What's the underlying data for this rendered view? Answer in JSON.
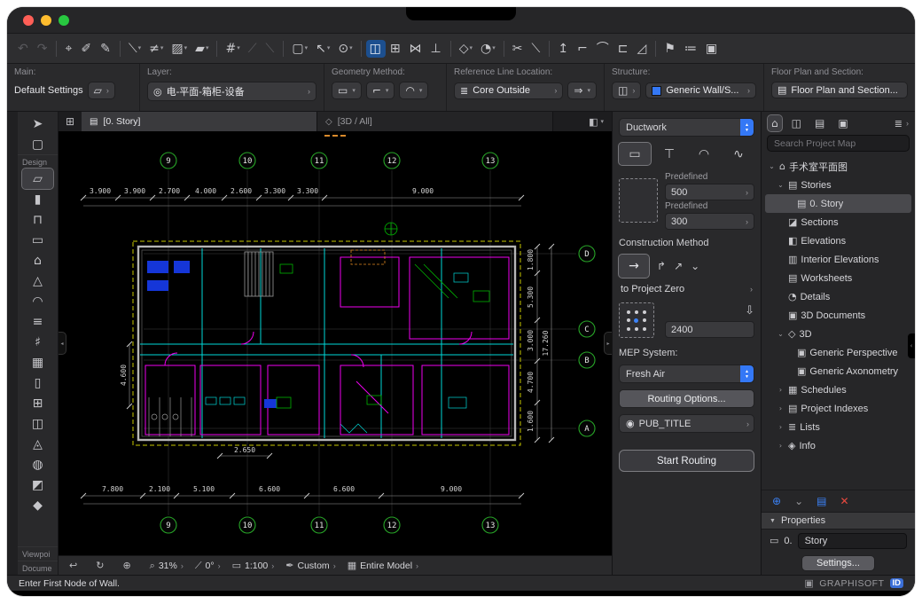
{
  "toolbar": {
    "icons": [
      {
        "name": "undo-icon",
        "glyph": "↶",
        "caret": "",
        "cls": "disabled",
        "inter": "true"
      },
      {
        "name": "redo-icon",
        "glyph": "↷",
        "caret": "",
        "cls": "disabled",
        "inter": "true"
      },
      {
        "name": "separator",
        "glyph": "",
        "caret": "",
        "cls": "sep",
        "inter": "false"
      },
      {
        "name": "find-select-icon",
        "glyph": "⌖",
        "caret": "",
        "cls": "",
        "inter": "true"
      },
      {
        "name": "pickup-parameters-icon",
        "glyph": "✐",
        "caret": "",
        "cls": "",
        "inter": "true"
      },
      {
        "name": "inject-parameters-icon",
        "glyph": "✎",
        "caret": "",
        "cls": "",
        "inter": "true"
      },
      {
        "name": "separator",
        "glyph": "",
        "caret": "",
        "cls": "sep",
        "inter": "false"
      },
      {
        "name": "line-style-icon",
        "glyph": "⟍",
        "caret": "▾",
        "cls": "",
        "inter": "true"
      },
      {
        "name": "dimension-style-icon",
        "glyph": "≠",
        "caret": "▾",
        "cls": "",
        "inter": "true"
      },
      {
        "name": "fill-style-icon",
        "glyph": "▨",
        "caret": "▾",
        "cls": "",
        "inter": "true"
      },
      {
        "name": "pen-set-icon",
        "glyph": "▰",
        "caret": "▾",
        "cls": "",
        "inter": "true"
      },
      {
        "name": "separator",
        "glyph": "",
        "caret": "",
        "cls": "sep",
        "inter": "false"
      },
      {
        "name": "grid-snap-icon",
        "glyph": "#",
        "caret": "▾",
        "cls": "",
        "inter": "true"
      },
      {
        "name": "guide-lines-icon",
        "glyph": "⟋",
        "caret": "",
        "cls": "disabled",
        "inter": "true"
      },
      {
        "name": "snap-guides-icon",
        "glyph": "⟍",
        "caret": "",
        "cls": "disabled",
        "inter": "true"
      },
      {
        "name": "separator",
        "glyph": "",
        "caret": "",
        "cls": "sep",
        "inter": "false"
      },
      {
        "name": "marquee-options-icon",
        "glyph": "▢",
        "caret": "▾",
        "cls": "",
        "inter": "true"
      },
      {
        "name": "cursor-snap-icon",
        "glyph": "↖",
        "caret": "▾",
        "cls": "",
        "inter": "true"
      },
      {
        "name": "suspend-groups-icon",
        "glyph": "⊙",
        "caret": "▾",
        "cls": "",
        "inter": "true"
      },
      {
        "name": "separator",
        "glyph": "",
        "caret": "",
        "cls": "sep",
        "inter": "false"
      },
      {
        "name": "magic-routing-icon",
        "glyph": "◫",
        "caret": "",
        "cls": "selected",
        "inter": "true"
      },
      {
        "name": "gravity-icon",
        "glyph": "⊞",
        "caret": "",
        "cls": "",
        "inter": "true"
      },
      {
        "name": "intersect-icon",
        "glyph": "⋈",
        "caret": "",
        "cls": "",
        "inter": "true"
      },
      {
        "name": "trim-icon",
        "glyph": "⊥",
        "caret": "",
        "cls": "",
        "inter": "true"
      },
      {
        "name": "separator",
        "glyph": "",
        "caret": "",
        "cls": "sep",
        "inter": "false"
      },
      {
        "name": "shape-options-icon",
        "glyph": "◇",
        "caret": "▾",
        "cls": "",
        "inter": "true"
      },
      {
        "name": "rotate-options-icon",
        "glyph": "◔",
        "caret": "▾",
        "cls": "",
        "inter": "true"
      },
      {
        "name": "separator",
        "glyph": "",
        "caret": "",
        "cls": "sep",
        "inter": "false"
      },
      {
        "name": "cut-icon",
        "glyph": "✂",
        "caret": "",
        "cls": "",
        "inter": "true"
      },
      {
        "name": "split-icon",
        "glyph": "⟍",
        "caret": "",
        "cls": "",
        "inter": "true"
      },
      {
        "name": "separator",
        "glyph": "",
        "caret": "",
        "cls": "sep",
        "inter": "false"
      },
      {
        "name": "elevate-icon",
        "glyph": "↥",
        "caret": "",
        "cls": "",
        "inter": "true"
      },
      {
        "name": "corner-icon",
        "glyph": "⌐",
        "caret": "",
        "cls": "",
        "inter": "true"
      },
      {
        "name": "fillet-icon",
        "glyph": "⌒",
        "caret": "",
        "cls": "",
        "inter": "true"
      },
      {
        "name": "stretch-icon",
        "glyph": "⊏",
        "caret": "",
        "cls": "",
        "inter": "true"
      },
      {
        "name": "resize-icon",
        "glyph": "◿",
        "caret": "",
        "cls": "",
        "inter": "true"
      },
      {
        "name": "separator",
        "glyph": "",
        "caret": "",
        "cls": "sep",
        "inter": "false"
      },
      {
        "name": "flag-icon",
        "glyph": "⚑",
        "caret": "",
        "cls": "",
        "inter": "true"
      },
      {
        "name": "markup-list-icon",
        "glyph": "≔",
        "caret": "",
        "cls": "",
        "inter": "true"
      },
      {
        "name": "layout-icon",
        "glyph": "▣",
        "caret": "",
        "cls": "",
        "inter": "true"
      }
    ]
  },
  "infobox": {
    "main_label": "Main:",
    "default_settings": "Default Settings",
    "layer_label": "Layer:",
    "layer_value": "电-平面-箱柜-设备",
    "geometry_label": "Geometry Method:",
    "refline_label": "Reference Line Location:",
    "refline_value": "Core Outside",
    "structure_label": "Structure:",
    "structure_value": "Generic Wall/S...",
    "floorplan_label": "Floor Plan and Section:",
    "floorplan_value": "Floor Plan and Section..."
  },
  "tabs": {
    "items": [
      {
        "name": "tab-story",
        "glyph": "▤",
        "label": "[0. Story]",
        "cls": "active",
        "inter": "true"
      },
      {
        "name": "tab-3d-all",
        "glyph": "◇",
        "label": "[3D / All]",
        "cls": "",
        "inter": "true"
      }
    ],
    "right_glyph": "◧",
    "right_caret": "▾"
  },
  "toolbox": {
    "items": [
      {
        "name": "arrow-tool",
        "glyph": "➤",
        "label": "",
        "cls": "tool",
        "inter": "true"
      },
      {
        "name": "marquee-tool",
        "glyph": "▢",
        "label": "",
        "cls": "tool",
        "inter": "true"
      },
      {
        "name": "section-design-label",
        "glyph": "",
        "label": "Design",
        "cls": "label",
        "inter": "false"
      },
      {
        "name": "wall-tool",
        "glyph": "▱",
        "label": "",
        "cls": "tool selected",
        "inter": "true"
      },
      {
        "name": "column-tool",
        "glyph": "▮",
        "label": "",
        "cls": "tool",
        "inter": "true"
      },
      {
        "name": "beam-tool",
        "glyph": "⊓",
        "label": "",
        "cls": "tool",
        "inter": "true"
      },
      {
        "name": "slab-tool",
        "glyph": "▭",
        "label": "",
        "cls": "tool",
        "inter": "true"
      },
      {
        "name": "roof-tool",
        "glyph": "⌂",
        "label": "",
        "cls": "tool",
        "inter": "true"
      },
      {
        "name": "mesh-tool",
        "glyph": "△",
        "label": "",
        "cls": "tool",
        "inter": "true"
      },
      {
        "name": "shell-tool",
        "glyph": "◠",
        "label": "",
        "cls": "tool",
        "inter": "true"
      },
      {
        "name": "stair-tool",
        "glyph": "≡",
        "label": "",
        "cls": "tool",
        "inter": "true"
      },
      {
        "name": "railing-tool",
        "glyph": "♯",
        "label": "",
        "cls": "tool",
        "inter": "true"
      },
      {
        "name": "curtain-wall-tool",
        "glyph": "▦",
        "label": "",
        "cls": "tool",
        "inter": "true"
      },
      {
        "name": "door-tool",
        "glyph": "▯",
        "label": "",
        "cls": "tool",
        "inter": "true"
      },
      {
        "name": "window-tool",
        "glyph": "⊞",
        "label": "",
        "cls": "tool",
        "inter": "true"
      },
      {
        "name": "skylight-tool",
        "glyph": "◫",
        "label": "",
        "cls": "tool",
        "inter": "true"
      },
      {
        "name": "object-tool",
        "glyph": "◬",
        "label": "",
        "cls": "tool",
        "inter": "true"
      },
      {
        "name": "lamp-tool",
        "glyph": "◍",
        "label": "",
        "cls": "tool",
        "inter": "true"
      },
      {
        "name": "zone-tool",
        "glyph": "◩",
        "label": "",
        "cls": "tool",
        "inter": "true"
      },
      {
        "name": "morph-tool",
        "glyph": "◆",
        "label": "",
        "cls": "tool",
        "inter": "true"
      },
      {
        "name": "section-viewpoint-label",
        "glyph": "",
        "label": "Viewpoi",
        "cls": "label push",
        "inter": "false"
      },
      {
        "name": "section-document-label",
        "glyph": "",
        "label": "Docume",
        "cls": "label",
        "inter": "false"
      }
    ]
  },
  "settings": {
    "element_type": "Ductwork",
    "geometry_icons": [
      {
        "name": "duct-straight-icon",
        "glyph": "▭",
        "cls": "selected",
        "inter": "true"
      },
      {
        "name": "duct-branch-icon",
        "glyph": "⊤",
        "cls": "",
        "inter": "true"
      },
      {
        "name": "duct-elbow-icon",
        "glyph": "◠",
        "cls": "",
        "inter": "true"
      },
      {
        "name": "duct-flexible-icon",
        "glyph": "∿",
        "cls": "",
        "inter": "true"
      }
    ],
    "predefined_label_1": "Predefined",
    "size_1": "500",
    "predefined_label_2": "Predefined",
    "size_2": "300",
    "construction_method_label": "Construction Method",
    "reference_label": "to Project Zero",
    "elevation_value": "2400",
    "mep_label": "MEP System:",
    "mep_value": "Fresh Air",
    "routing_options_label": "Routing Options...",
    "pub_title": "PUB_TITLE",
    "start_routing_label": "Start Routing"
  },
  "navigator": {
    "header_icons": [
      {
        "name": "project-map-icon",
        "glyph": "⌂",
        "cls": "selected",
        "inter": "true"
      },
      {
        "name": "view-map-icon",
        "glyph": "◫",
        "cls": "",
        "inter": "true"
      },
      {
        "name": "layout-book-icon",
        "glyph": "▤",
        "cls": "",
        "inter": "true"
      },
      {
        "name": "publisher-sets-icon",
        "glyph": "▣",
        "cls": "",
        "inter": "true"
      }
    ],
    "menu_icon": "≣",
    "menu_chev": "›",
    "search_placeholder": "Search Project Map",
    "tree": [
      {
        "name": "tree-project-root",
        "chev": "⌄",
        "glyph": "⌂",
        "label": "手术室平面图",
        "cls": "ind0",
        "inter": "true"
      },
      {
        "name": "tree-stories",
        "chev": "⌄",
        "glyph": "▤",
        "label": "Stories",
        "cls": "ind1",
        "inter": "true"
      },
      {
        "name": "tree-story-0",
        "chev": "",
        "glyph": "▤",
        "label": "0. Story",
        "cls": "ind2 selected",
        "inter": "true"
      },
      {
        "name": "tree-sections",
        "chev": "",
        "glyph": "◪",
        "label": "Sections",
        "cls": "ind1",
        "inter": "true"
      },
      {
        "name": "tree-elevations",
        "chev": "",
        "glyph": "◧",
        "label": "Elevations",
        "cls": "ind1",
        "inter": "true"
      },
      {
        "name": "tree-interior-elevations",
        "chev": "",
        "glyph": "▥",
        "label": "Interior Elevations",
        "cls": "ind1",
        "inter": "true"
      },
      {
        "name": "tree-worksheets",
        "chev": "",
        "glyph": "▤",
        "label": "Worksheets",
        "cls": "ind1",
        "inter": "true"
      },
      {
        "name": "tree-details",
        "chev": "",
        "glyph": "◔",
        "label": "Details",
        "cls": "ind1",
        "inter": "true"
      },
      {
        "name": "tree-3d-documents",
        "chev": "",
        "glyph": "▣",
        "label": "3D Documents",
        "cls": "ind1",
        "inter": "true"
      },
      {
        "name": "tree-3d",
        "chev": "⌄",
        "glyph": "◇",
        "label": "3D",
        "cls": "ind1",
        "inter": "true"
      },
      {
        "name": "tree-generic-perspective",
        "chev": "",
        "glyph": "▣",
        "label": "Generic Perspective",
        "cls": "ind2",
        "inter": "true"
      },
      {
        "name": "tree-generic-axonometry",
        "chev": "",
        "glyph": "▣",
        "label": "Generic Axonometry",
        "cls": "ind2",
        "inter": "true"
      },
      {
        "name": "tree-schedules",
        "chev": "›",
        "glyph": "▦",
        "label": "Schedules",
        "cls": "ind1",
        "inter": "true"
      },
      {
        "name": "tree-project-indexes",
        "chev": "›",
        "glyph": "▤",
        "label": "Project Indexes",
        "cls": "ind1",
        "inter": "true"
      },
      {
        "name": "tree-lists",
        "chev": "›",
        "glyph": "≣",
        "label": "Lists",
        "cls": "ind1",
        "inter": "true"
      },
      {
        "name": "tree-info",
        "chev": "›",
        "glyph": "◈",
        "label": "Info",
        "cls": "ind1",
        "inter": "true"
      }
    ],
    "util_icons": [
      {
        "name": "add-viewpoint-icon",
        "glyph": "⊕",
        "cls": "blue",
        "inter": "true"
      },
      {
        "name": "collapse-all-icon",
        "glyph": "⌄",
        "cls": "",
        "inter": "true"
      },
      {
        "name": "clone-folder-icon",
        "glyph": "▤",
        "cls": "blue",
        "inter": "true"
      },
      {
        "name": "delete-item-icon",
        "glyph": "✕",
        "cls": "red",
        "inter": "true"
      }
    ],
    "properties_label": "Properties",
    "prop_story_prefix": "0.",
    "prop_story_value": "Story",
    "settings_button": "Settings..."
  },
  "bottombar": {
    "items": [
      {
        "name": "previous-view-icon",
        "icon": "↩",
        "text": "",
        "caret": "",
        "inter": "true"
      },
      {
        "name": "orbit-icon",
        "icon": "↻",
        "text": "",
        "caret": "",
        "inter": "true"
      },
      {
        "name": "zoom-in-icon",
        "icon": "⊕",
        "text": "",
        "caret": "",
        "inter": "true"
      },
      {
        "name": "zoom-level-menu",
        "icon": "⌕",
        "text": "31%",
        "caret": "›",
        "inter": "true"
      },
      {
        "name": "rotation-menu",
        "icon": "⟋",
        "text": "0°",
        "caret": "›",
        "inter": "true"
      },
      {
        "name": "scale-menu",
        "icon": "▭",
        "text": "1:100",
        "caret": "›",
        "inter": "true"
      },
      {
        "name": "pen-set-menu",
        "icon": "✒",
        "text": "Custom",
        "caret": "›",
        "inter": "true"
      },
      {
        "name": "model-filter-menu",
        "icon": "▦",
        "text": "Entire Model",
        "caret": "›",
        "inter": "true"
      }
    ]
  },
  "statusbar": {
    "message": "Enter First Node of Wall.",
    "brand": "GRAPHISOFT",
    "brand_id": "ID"
  },
  "plan": {
    "grid_cols": [
      "9",
      "10",
      "11",
      "12",
      "13"
    ],
    "grid_rows": [
      "D",
      "C",
      "B",
      "A"
    ],
    "dims_top": [
      "3.900",
      "3.900",
      "2.700",
      "4.000",
      "2.600",
      "3.300",
      "3.300",
      "9.000"
    ],
    "dims_bottom": [
      "7.800",
      "2.100",
      "5.100",
      "6.600",
      "6.600",
      "9.000"
    ],
    "dims_right": [
      "1.800",
      "5.300",
      "3.000",
      "4.700",
      "1.600"
    ],
    "dim_right_total": "17.260",
    "dim_left": "4.600",
    "dim_misc": "2.650"
  }
}
